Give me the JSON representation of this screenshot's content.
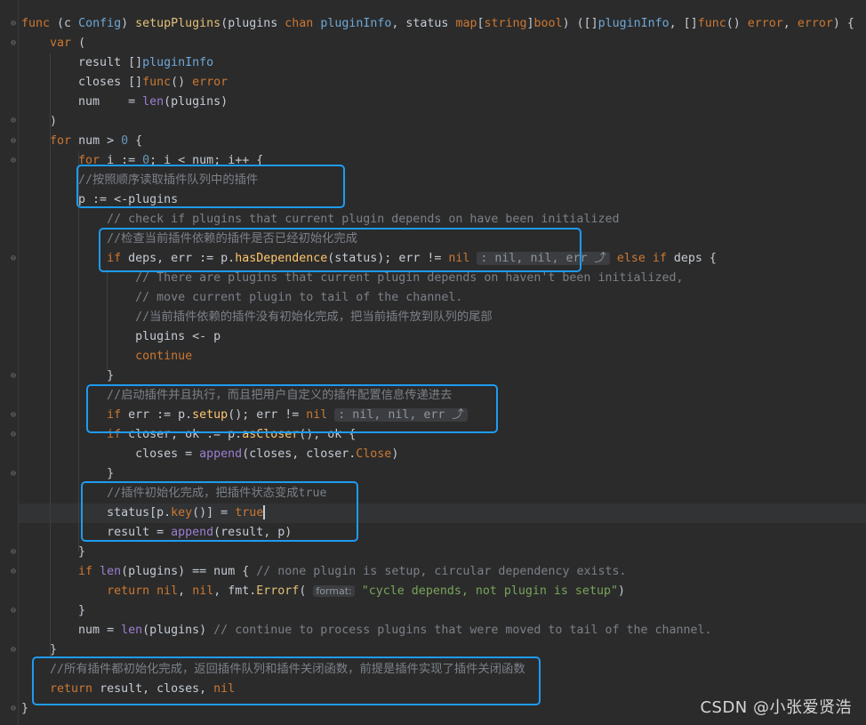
{
  "editor": {
    "lines": [
      [
        {
          "t": "func",
          "c": "kw"
        },
        {
          "t": " (c "
        },
        {
          "t": "Config",
          "c": "tp"
        },
        {
          "t": ") "
        },
        {
          "t": "setupPlugins",
          "c": "fn"
        },
        {
          "t": "(plugins "
        },
        {
          "t": "chan",
          "c": "kw"
        },
        {
          "t": " "
        },
        {
          "t": "pluginInfo",
          "c": "tp"
        },
        {
          "t": ", status "
        },
        {
          "t": "map",
          "c": "kw"
        },
        {
          "t": "["
        },
        {
          "t": "string",
          "c": "kw"
        },
        {
          "t": "]"
        },
        {
          "t": "bool",
          "c": "kw"
        },
        {
          "t": ") ([]"
        },
        {
          "t": "pluginInfo",
          "c": "tp"
        },
        {
          "t": ", []"
        },
        {
          "t": "func",
          "c": "kw"
        },
        {
          "t": "() "
        },
        {
          "t": "error",
          "c": "kw"
        },
        {
          "t": ", "
        },
        {
          "t": "error",
          "c": "kw"
        },
        {
          "t": ") {"
        }
      ],
      [
        {
          "t": "    "
        },
        {
          "t": "var",
          "c": "kw"
        },
        {
          "t": " ("
        }
      ],
      [
        {
          "t": "        result []"
        },
        {
          "t": "pluginInfo",
          "c": "tp"
        }
      ],
      [
        {
          "t": "        closes []"
        },
        {
          "t": "func",
          "c": "kw"
        },
        {
          "t": "() "
        },
        {
          "t": "error",
          "c": "kw"
        }
      ],
      [
        {
          "t": "        num    = "
        },
        {
          "t": "len",
          "c": "pr"
        },
        {
          "t": "(plugins)"
        }
      ],
      [
        {
          "t": "    )"
        }
      ],
      [
        {
          "t": "    "
        },
        {
          "t": "for",
          "c": "kw"
        },
        {
          "t": " num > "
        },
        {
          "t": "0",
          "c": "num"
        },
        {
          "t": " {"
        }
      ],
      [
        {
          "t": "        "
        },
        {
          "t": "for",
          "c": "kw"
        },
        {
          "t": " i := "
        },
        {
          "t": "0",
          "c": "num"
        },
        {
          "t": "; i < num; i++ {"
        }
      ],
      [
        {
          "t": "        "
        },
        {
          "t": "//按照顺序读取插件队列中的插件",
          "c": "cm"
        }
      ],
      [
        {
          "t": "        p := <-plugins"
        }
      ],
      [
        {
          "t": "            "
        },
        {
          "t": "// check if plugins that current plugin depends on have been initialized",
          "c": "cm"
        }
      ],
      [
        {
          "t": "            "
        },
        {
          "t": "//检查当前插件依赖的插件是否已经初始化完成",
          "c": "cm"
        }
      ],
      [
        {
          "t": "            "
        },
        {
          "t": "if",
          "c": "kw"
        },
        {
          "t": " deps, err := p."
        },
        {
          "t": "hasDependence",
          "c": "mc"
        },
        {
          "t": "(status); err != "
        },
        {
          "t": "nil",
          "c": "kw"
        },
        {
          "t": " "
        },
        {
          "t": ": nil, nil, err ⤴",
          "c": "hint"
        },
        {
          "t": " "
        },
        {
          "t": "else",
          "c": "kw"
        },
        {
          "t": " "
        },
        {
          "t": "if",
          "c": "kw"
        },
        {
          "t": " deps {"
        }
      ],
      [
        {
          "t": "                "
        },
        {
          "t": "// There are plugins that current plugin depends on haven't been initialized,",
          "c": "cm"
        }
      ],
      [
        {
          "t": "                "
        },
        {
          "t": "// move current plugin to tail of the channel.",
          "c": "cm"
        }
      ],
      [
        {
          "t": "                "
        },
        {
          "t": "//当前插件依赖的插件没有初始化完成，把当前插件放到队列的尾部",
          "c": "cm"
        }
      ],
      [
        {
          "t": "                plugins <- p"
        }
      ],
      [
        {
          "t": "                "
        },
        {
          "t": "continue",
          "c": "kw"
        }
      ],
      [
        {
          "t": "            }"
        }
      ],
      [
        {
          "t": "            "
        },
        {
          "t": "//启动插件并且执行，而且把用户自定义的插件配置信息传递进去",
          "c": "cm"
        }
      ],
      [
        {
          "t": "            "
        },
        {
          "t": "if",
          "c": "kw"
        },
        {
          "t": " err := p."
        },
        {
          "t": "setup",
          "c": "mc"
        },
        {
          "t": "(); err != "
        },
        {
          "t": "nil",
          "c": "kw"
        },
        {
          "t": " "
        },
        {
          "t": ": nil, nil, err ⤴",
          "c": "hint"
        }
      ],
      [
        {
          "t": "            "
        },
        {
          "t": "if",
          "c": "kw"
        },
        {
          "t": " closer, ok := p."
        },
        {
          "t": "asCloser",
          "c": "mc"
        },
        {
          "t": "(); ok {"
        }
      ],
      [
        {
          "t": "                closes = "
        },
        {
          "t": "append",
          "c": "pr"
        },
        {
          "t": "(closes, closer."
        },
        {
          "t": "Close",
          "c": "tr"
        },
        {
          "t": ")"
        }
      ],
      [
        {
          "t": "            }"
        }
      ],
      [
        {
          "t": "            "
        },
        {
          "t": "//插件初始化完成，把插件状态变成true",
          "c": "cm"
        }
      ],
      [
        {
          "t": "            status[p."
        },
        {
          "t": "key",
          "c": "tr"
        },
        {
          "t": "()] = "
        },
        {
          "t": "true",
          "c": "kw"
        },
        {
          "t": "",
          "c": "caret"
        }
      ],
      [
        {
          "t": "            result = "
        },
        {
          "t": "append",
          "c": "pr"
        },
        {
          "t": "(result, p)"
        }
      ],
      [
        {
          "t": "        }"
        }
      ],
      [
        {
          "t": "        "
        },
        {
          "t": "if",
          "c": "kw"
        },
        {
          "t": " "
        },
        {
          "t": "len",
          "c": "pr"
        },
        {
          "t": "(plugins) == num { "
        },
        {
          "t": "// none plugin is setup, circular dependency exists.",
          "c": "cm"
        }
      ],
      [
        {
          "t": "            "
        },
        {
          "t": "return",
          "c": "kw"
        },
        {
          "t": " "
        },
        {
          "t": "nil",
          "c": "kw"
        },
        {
          "t": ", "
        },
        {
          "t": "nil",
          "c": "kw"
        },
        {
          "t": ", fmt."
        },
        {
          "t": "Errorf",
          "c": "fn"
        },
        {
          "t": "( "
        },
        {
          "t": "format:",
          "c": "hint-label"
        },
        {
          "t": " "
        },
        {
          "t": "\"cycle depends, not plugin is setup\"",
          "c": "str"
        },
        {
          "t": ")"
        }
      ],
      [
        {
          "t": "        }"
        }
      ],
      [
        {
          "t": "        num = "
        },
        {
          "t": "len",
          "c": "pr"
        },
        {
          "t": "(plugins) "
        },
        {
          "t": "// continue to process plugins that were moved to tail of the channel.",
          "c": "cm"
        }
      ],
      [
        {
          "t": "    }"
        }
      ],
      [
        {
          "t": "    "
        },
        {
          "t": "//所有插件都初始化完成，返回插件队列和插件关闭函数，前提是插件实现了插件关闭函数",
          "c": "cm"
        }
      ],
      [
        {
          "t": "    "
        },
        {
          "t": "return",
          "c": "kw"
        },
        {
          "t": " result, closes, "
        },
        {
          "t": "nil",
          "c": "kw"
        }
      ],
      [
        {
          "t": "}"
        }
      ]
    ]
  },
  "colors": {
    "background": "#2b2b2b",
    "highlight_box": "#1e9bf0"
  },
  "watermark": "CSDN @小张爱贤浩"
}
